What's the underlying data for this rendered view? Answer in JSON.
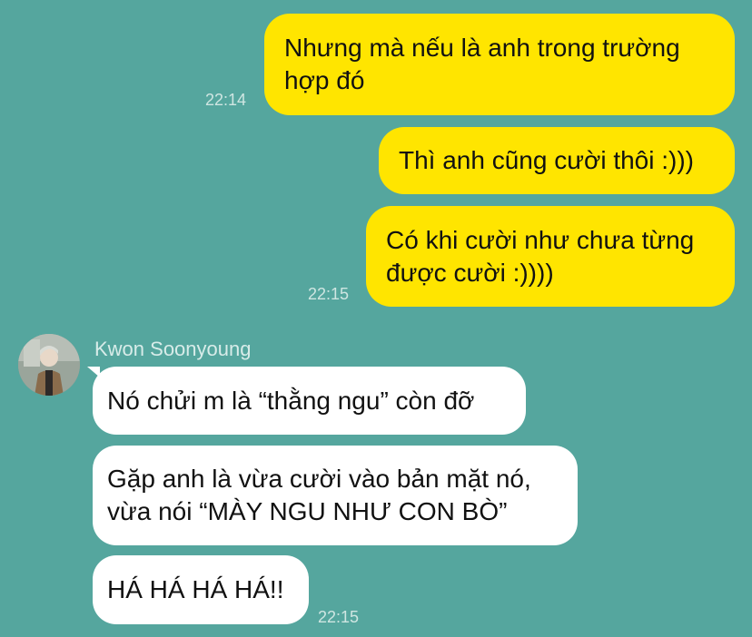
{
  "outgoing": [
    {
      "text": "Nhưng mà nếu là anh trong trường\nhợp đó",
      "time": "22:14"
    },
    {
      "text": "Thì anh cũng cười thôi :)))",
      "time": ""
    },
    {
      "text": "Có khi cười như chưa từng\nđược cười :))))",
      "time": "22:15"
    }
  ],
  "contact": {
    "name": "Kwon Soonyoung",
    "avatar_icon": "profile-photo-icon"
  },
  "incoming": [
    {
      "text": "Nó chửi m là “thằng ngu” còn đỡ",
      "time": ""
    },
    {
      "text": "Gặp anh là vừa cười vào bản mặt nó,\nvừa nói “MÀY NGU NHƯ CON BÒ”",
      "time": ""
    },
    {
      "text": "HÁ HÁ HÁ HÁ!!",
      "time": "22:15"
    }
  ],
  "colors": {
    "background": "#55a69e",
    "outgoing_bubble": "#ffe500",
    "incoming_bubble": "#ffffff"
  }
}
